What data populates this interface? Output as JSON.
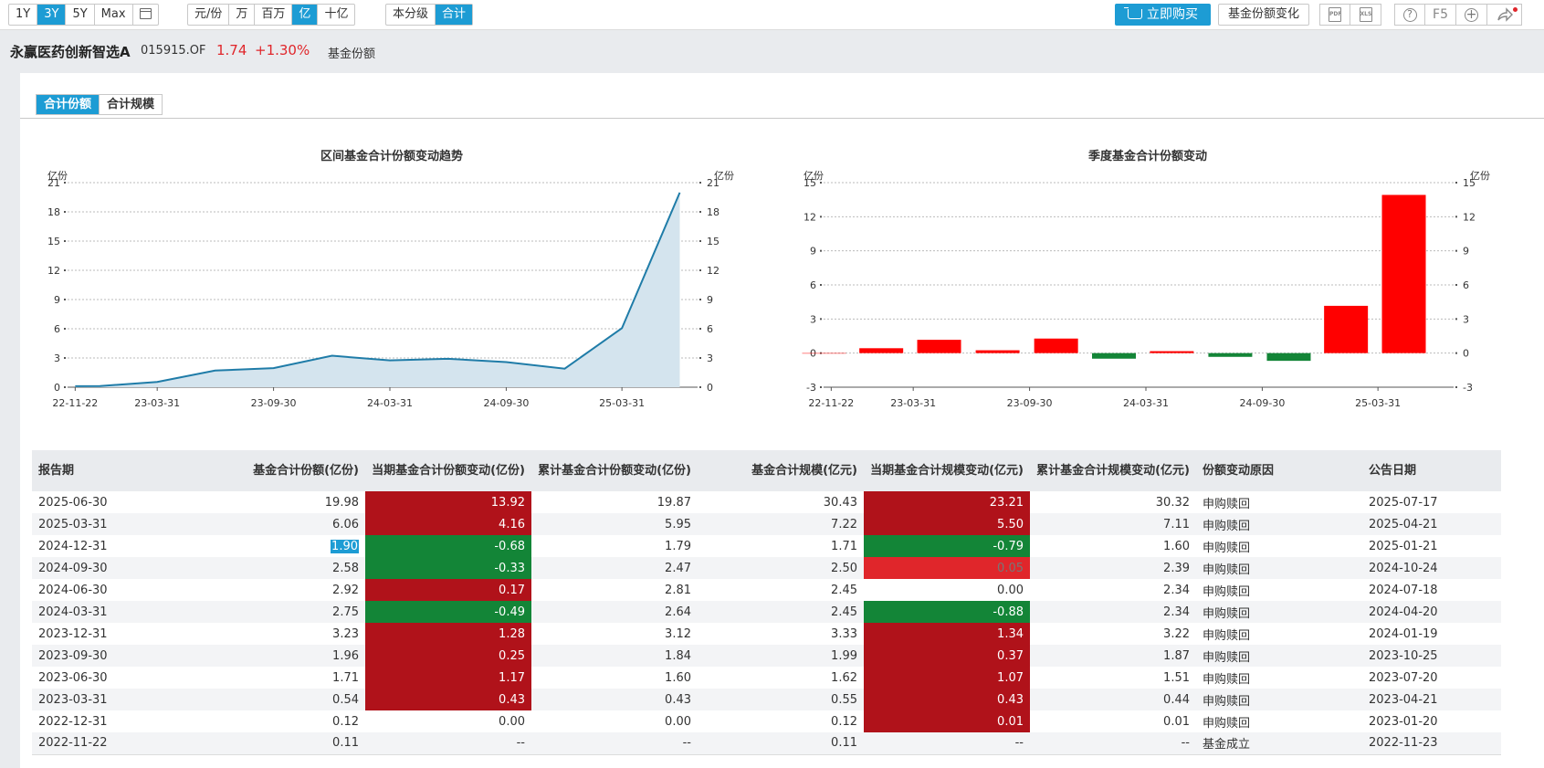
{
  "toolbar": {
    "period_buttons": [
      "1Y",
      "3Y",
      "5Y",
      "Max"
    ],
    "period_active": "3Y",
    "unit_buttons": [
      "元/份",
      "万",
      "百万",
      "亿",
      "十亿"
    ],
    "unit_active": "亿",
    "level_buttons": [
      "本分级",
      "合计"
    ],
    "level_active": "合计",
    "buy_label": "立即购买",
    "share_change_label": "基金份额变化",
    "pdf_label": "PDF",
    "xls_label": "XLS",
    "help_label": "?",
    "f5_label": "F5",
    "add_label": "+"
  },
  "fund": {
    "name": "永赢医药创新智选A",
    "code": "015915.OF",
    "nav": "1.74",
    "change": "+1.30%",
    "section": "基金份额"
  },
  "tabs": [
    {
      "label": "合计份额",
      "active": true
    },
    {
      "label": "合计规模",
      "active": false
    }
  ],
  "charts": {
    "left": {
      "title": "区间基金合计份额变动趋势",
      "unit_left": "亿份",
      "unit_right": "亿份"
    },
    "right": {
      "title": "季度基金合计份额变动",
      "unit_left": "亿份",
      "unit_right": "亿份"
    }
  },
  "chart_data": [
    {
      "type": "area",
      "title": "区间基金合计份额变动趋势",
      "ylabel": "亿份",
      "ylim": [
        0,
        21
      ],
      "yticks": [
        0,
        3,
        6,
        9,
        12,
        15,
        18,
        21
      ],
      "xticks": [
        "22-11-22",
        "23-03-31",
        "23-09-30",
        "24-03-31",
        "24-09-30",
        "25-03-31"
      ],
      "x": [
        "2022-11-22",
        "2022-12-31",
        "2023-03-31",
        "2023-06-30",
        "2023-09-30",
        "2023-12-31",
        "2024-03-31",
        "2024-06-30",
        "2024-09-30",
        "2024-12-31",
        "2025-03-31",
        "2025-06-30"
      ],
      "values": [
        0.11,
        0.12,
        0.54,
        1.71,
        1.96,
        3.23,
        2.75,
        2.92,
        2.58,
        1.9,
        6.06,
        19.98
      ],
      "color": "#1f7ca8",
      "fill": "#d4e4ee",
      "grid": true
    },
    {
      "type": "bar",
      "title": "季度基金合计份额变动",
      "ylabel": "亿份",
      "ylim": [
        -3,
        15
      ],
      "yticks": [
        -3,
        0,
        3,
        6,
        9,
        12,
        15
      ],
      "xticks": [
        "22-11-22",
        "23-03-31",
        "23-09-30",
        "24-03-31",
        "24-09-30",
        "25-03-31"
      ],
      "x": [
        "2022-12-31",
        "2023-03-31",
        "2023-06-30",
        "2023-09-30",
        "2023-12-31",
        "2024-03-31",
        "2024-06-30",
        "2024-09-30",
        "2024-12-31",
        "2025-03-31",
        "2025-06-30"
      ],
      "values": [
        0.0,
        0.43,
        1.17,
        0.25,
        1.28,
        -0.49,
        0.17,
        -0.33,
        -0.68,
        4.16,
        13.92
      ],
      "positive_color": "#ff0000",
      "negative_color": "#138537",
      "grid": true
    }
  ],
  "table": {
    "headers": [
      {
        "label": "报告期",
        "align": "txt"
      },
      {
        "label": "基金合计份额(亿份)",
        "align": "num"
      },
      {
        "label": "当期基金合计份额变动(亿份)",
        "align": "num"
      },
      {
        "label": "累计基金合计份额变动(亿份)",
        "align": "num"
      },
      {
        "label": "基金合计规模(亿元)",
        "align": "num"
      },
      {
        "label": "当期基金合计规模变动(亿元)",
        "align": "num"
      },
      {
        "label": "累计基金合计规模变动(亿元)",
        "align": "num"
      },
      {
        "label": "份额变动原因",
        "align": "txt"
      },
      {
        "label": "公告日期",
        "align": "txt"
      }
    ],
    "rows": [
      [
        "2025-06-30",
        "19.98",
        "13.92",
        "19.87",
        "30.43",
        "23.21",
        "30.32",
        "申购赎回",
        "2025-07-17"
      ],
      [
        "2025-03-31",
        "6.06",
        "4.16",
        "5.95",
        "7.22",
        "5.50",
        "7.11",
        "申购赎回",
        "2025-04-21"
      ],
      [
        "2024-12-31",
        "1.90",
        "-0.68",
        "1.79",
        "1.71",
        "-0.79",
        "1.60",
        "申购赎回",
        "2025-01-21"
      ],
      [
        "2024-09-30",
        "2.58",
        "-0.33",
        "2.47",
        "2.50",
        "0.05",
        "2.39",
        "申购赎回",
        "2024-10-24"
      ],
      [
        "2024-06-30",
        "2.92",
        "0.17",
        "2.81",
        "2.45",
        "0.00",
        "2.34",
        "申购赎回",
        "2024-07-18"
      ],
      [
        "2024-03-31",
        "2.75",
        "-0.49",
        "2.64",
        "2.45",
        "-0.88",
        "2.34",
        "申购赎回",
        "2024-04-20"
      ],
      [
        "2023-12-31",
        "3.23",
        "1.28",
        "3.12",
        "3.33",
        "1.34",
        "3.22",
        "申购赎回",
        "2024-01-19"
      ],
      [
        "2023-09-30",
        "1.96",
        "0.25",
        "1.84",
        "1.99",
        "0.37",
        "1.87",
        "申购赎回",
        "2023-10-25"
      ],
      [
        "2023-06-30",
        "1.71",
        "1.17",
        "1.60",
        "1.62",
        "1.07",
        "1.51",
        "申购赎回",
        "2023-07-20"
      ],
      [
        "2023-03-31",
        "0.54",
        "0.43",
        "0.43",
        "0.55",
        "0.43",
        "0.44",
        "申购赎回",
        "2023-04-21"
      ],
      [
        "2022-12-31",
        "0.12",
        "0.00",
        "0.00",
        "0.12",
        "0.01",
        "0.01",
        "申购赎回",
        "2023-01-20"
      ],
      [
        "2022-11-22",
        "0.11",
        "--",
        "--",
        "0.11",
        "--",
        "--",
        "基金成立",
        "2022-11-23"
      ]
    ],
    "cell_colors": {
      "2": [
        "dred",
        "dred",
        "green",
        "green",
        "dred",
        "green",
        "dred",
        "dred",
        "dred",
        "dred",
        "",
        ""
      ],
      "5": [
        "dred",
        "dred",
        "green",
        "red",
        "",
        "green",
        "dred",
        "dred",
        "dred",
        "dred",
        "dred",
        ""
      ]
    },
    "highlighted_cell": {
      "row": 2,
      "col": 1
    }
  }
}
